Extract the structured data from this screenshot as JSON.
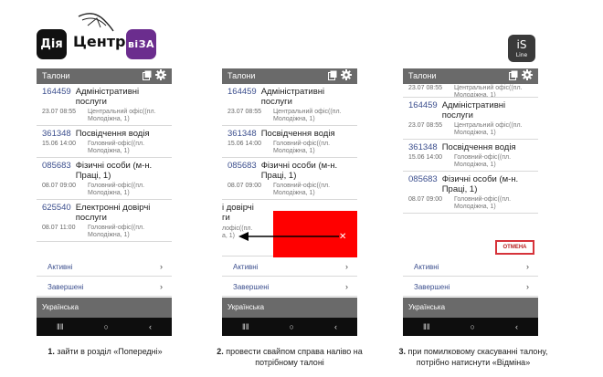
{
  "logos": {
    "dia": "Дія",
    "centr": "Центр",
    "viza": "віЗА",
    "isline_top": "iS",
    "isline_bottom": "Line"
  },
  "app": {
    "title": "Талони",
    "language": "Українська",
    "active_label": "Активні",
    "completed_label": "Завершені",
    "cancel_label": "ОТМЕНА"
  },
  "tickets": [
    {
      "number": "164459",
      "service": "Адміністративні послуги",
      "date": "23.07 08:55",
      "office": "Центральний офіс((пл. Молодіжна, 1)"
    },
    {
      "number": "361348",
      "service": "Посвідчення водія",
      "date": "15.06 14:00",
      "office": "Головний-офіс((пл. Молодіжна, 1)"
    },
    {
      "number": "085683",
      "service": "Фізичні особи (м-н. Праці, 1)",
      "date": "08.07 09:00",
      "office": "Головний-офіс((пл. Молодіжна, 1)"
    },
    {
      "number": "625540",
      "service": "Електронні довірчі послуги",
      "date": "08.07 11:00",
      "office": "Головний-офіс((пл. Молодіжна, 1)"
    }
  ],
  "swiped_item": {
    "line1": "і довірчі",
    "line2": "ги",
    "office_line1": "лофіс((пл.",
    "office_line2": "а, 1)"
  },
  "captions": [
    {
      "number": "1.",
      "text": " зайти в розділ  «Попередні»"
    },
    {
      "number": "2.",
      "text": " провести свайпом справа наліво на потрібному талоні"
    },
    {
      "number": "3.",
      "text": " при помилковому скасуванні талону, потрібно натиснути  «Відміна»"
    }
  ],
  "colors": {
    "appbar": "#6a6a6a",
    "ticket_number": "#3c4f8e",
    "swipe_red": "#ff0000",
    "cancel_border": "#d6333a",
    "viza_brand": "#6b2d8e"
  }
}
